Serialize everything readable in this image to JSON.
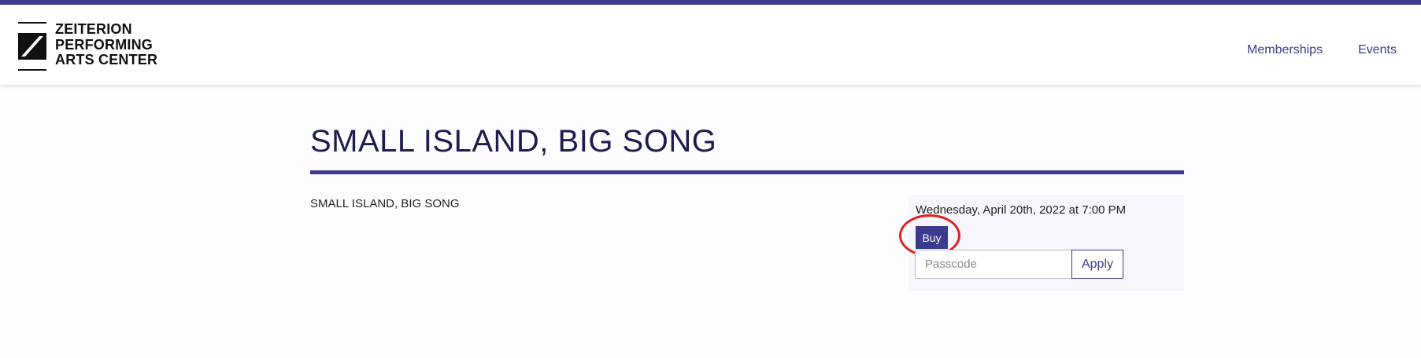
{
  "header": {
    "logo_lines": [
      "ZEITERION",
      "PERFORMING",
      "ARTS CENTER"
    ],
    "nav": [
      {
        "label": "Memberships"
      },
      {
        "label": "Events"
      }
    ]
  },
  "event": {
    "title": "SMALL ISLAND, BIG SONG",
    "description": "SMALL ISLAND, BIG SONG",
    "performance_date": "Wednesday, April 20th, 2022 at 7:00 PM",
    "buy_label": "Buy",
    "passcode_placeholder": "Passcode",
    "apply_label": "Apply"
  },
  "colors": {
    "accent": "#3a3a8f",
    "title_text": "#1d1d4f",
    "annotation": "#e02020"
  },
  "icons": {
    "logo": "zeiterion-z-logo-icon"
  }
}
